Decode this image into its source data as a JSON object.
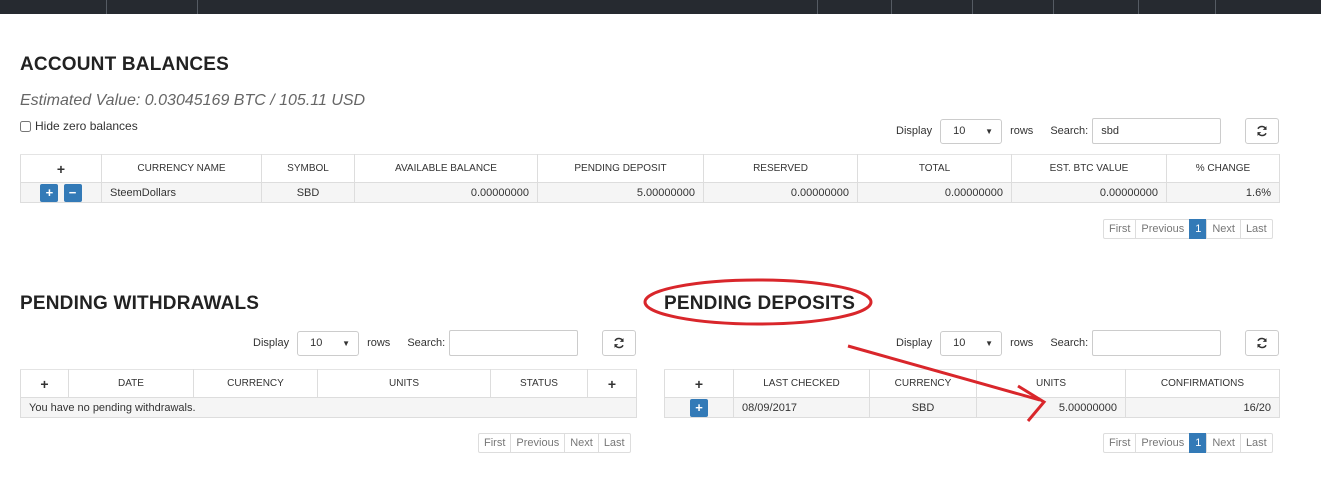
{
  "balances": {
    "title": "ACCOUNT BALANCES",
    "estimated": "Estimated Value: 0.03045169 BTC / 105.11 USD",
    "hide_zero": "Hide zero balances",
    "display_label": "Display",
    "display_value": "10",
    "rows_label": "rows",
    "search_label": "Search:",
    "search_value": "sbd",
    "columns": [
      "+",
      "CURRENCY NAME",
      "SYMBOL",
      "AVAILABLE BALANCE",
      "PENDING DEPOSIT",
      "RESERVED",
      "TOTAL",
      "EST. BTC VALUE",
      "% CHANGE"
    ],
    "rows": [
      {
        "name": "SteemDollars",
        "symbol": "SBD",
        "available": "0.00000000",
        "pending": "5.00000000",
        "reserved": "0.00000000",
        "total": "0.00000000",
        "btc": "0.00000000",
        "change": "1.6%"
      }
    ],
    "pager": [
      "First",
      "Previous",
      "1",
      "Next",
      "Last"
    ]
  },
  "withdrawals": {
    "title": "PENDING WITHDRAWALS",
    "display_label": "Display",
    "display_value": "10",
    "rows_label": "rows",
    "search_label": "Search:",
    "search_value": "",
    "columns": [
      "+",
      "DATE",
      "CURRENCY",
      "UNITS",
      "STATUS",
      "+"
    ],
    "empty": "You have no pending withdrawals.",
    "pager": [
      "First",
      "Previous",
      "Next",
      "Last"
    ]
  },
  "deposits": {
    "title": "PENDING DEPOSITS",
    "display_label": "Display",
    "display_value": "10",
    "rows_label": "rows",
    "search_label": "Search:",
    "search_value": "",
    "columns": [
      "+",
      "LAST CHECKED",
      "CURRENCY",
      "UNITS",
      "CONFIRMATIONS"
    ],
    "rows": [
      {
        "date": "08/09/2017",
        "currency": "SBD",
        "units": "5.00000000",
        "confirmations": "16/20"
      }
    ],
    "pager": [
      "First",
      "Previous",
      "1",
      "Next",
      "Last"
    ]
  },
  "icons": {
    "plus_btn": "+",
    "minus_btn": "−",
    "caret": "▼"
  },
  "colors": {
    "accent": "#337ab7",
    "annotation": "#d9262b",
    "topbar": "#262a30"
  }
}
